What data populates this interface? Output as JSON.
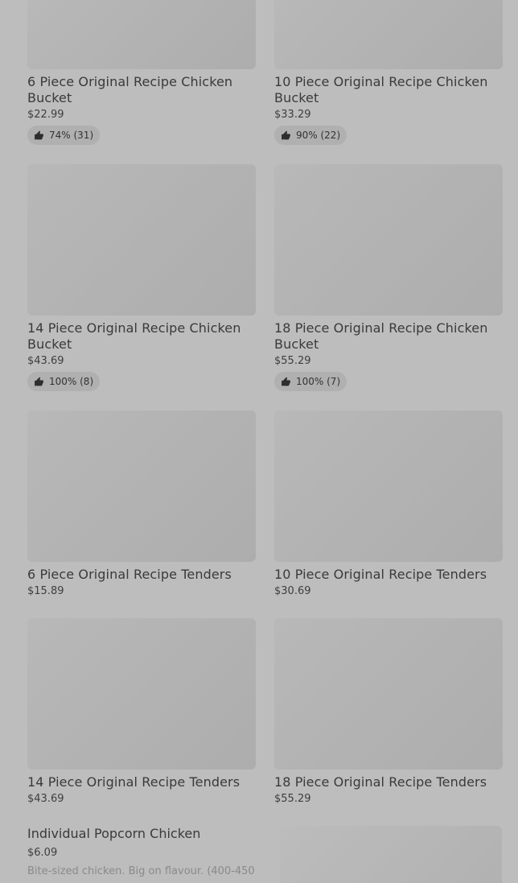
{
  "items": [
    {
      "title": "6 Piece Original Recipe Chicken Bucket",
      "price": "$22.99",
      "rating": "74% (31)"
    },
    {
      "title": "10 Piece Original Recipe Chicken Bucket",
      "price": "$33.29",
      "rating": "90% (22)"
    },
    {
      "title": "14 Piece Original Recipe Chicken Bucket",
      "price": "$43.69",
      "rating": "100% (8)"
    },
    {
      "title": "18 Piece Original Recipe Chicken Bucket",
      "price": "$55.29",
      "rating": "100% (7)"
    },
    {
      "title": "6 Piece Original Recipe Tenders",
      "price": "$15.89"
    },
    {
      "title": "10 Piece Original Recipe Tenders",
      "price": "$30.69"
    },
    {
      "title": "14 Piece Original Recipe Tenders",
      "price": "$43.69"
    },
    {
      "title": "18 Piece Original Recipe Tenders",
      "price": "$55.29"
    }
  ],
  "popcorn": {
    "title": "Individual Popcorn Chicken",
    "price": "$6.09",
    "description": "Bite-sized chicken. Big on flavour. (400-450"
  },
  "icons": {
    "rating": "thumbs-up-icon"
  }
}
